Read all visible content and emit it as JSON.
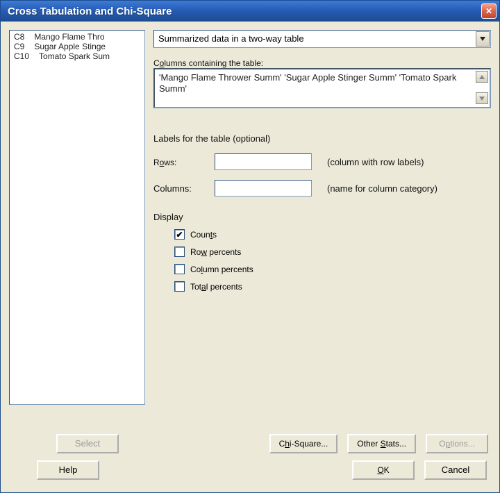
{
  "title": "Cross Tabulation and Chi-Square",
  "listbox": {
    "rows": [
      {
        "col": "C8",
        "name": "Mango Flame Thro"
      },
      {
        "col": "C9",
        "name": "Sugar Apple Stinge"
      },
      {
        "col": "C10",
        "name": "Tomato Spark Sum"
      }
    ]
  },
  "combo": {
    "selected": "Summarized data in a two-way table"
  },
  "columns_label": "Columns containing the table:",
  "columns_value": "'Mango Flame Thrower Summ' 'Sugar Apple Stinger Summ' 'Tomato Spark Summ'",
  "labels_header": "Labels for the table (optional)",
  "rows_label": "Rows:",
  "rows_label_pre": "R",
  "rows_label_u": "o",
  "rows_label_post": "ws:",
  "rows_hint": "(column with row labels)",
  "cols_label": "Columns:",
  "cols_hint": "(name for column category)",
  "display_label": "Display",
  "display": {
    "counts": {
      "label_pre": "Coun",
      "label_u": "t",
      "label_post": "s",
      "checked": true
    },
    "rowpct": {
      "label_pre": "Ro",
      "label_u": "w",
      "label_post": " percents",
      "checked": false
    },
    "colpct": {
      "label_pre": "Co",
      "label_u": "l",
      "label_post": "umn percents",
      "checked": false
    },
    "totpct": {
      "label_pre": "Tot",
      "label_u": "a",
      "label_post": "l percents",
      "checked": false
    }
  },
  "buttons": {
    "select": "Select",
    "chisq_pre": "C",
    "chisq_u": "h",
    "chisq_post": "i-Square...",
    "other_pre": "Other ",
    "other_u": "S",
    "other_post": "tats...",
    "options_pre": "O",
    "options_u": "p",
    "options_post": "tions...",
    "help": "Help",
    "ok_pre": "",
    "ok_u": "O",
    "ok_post": "K",
    "cancel": "Cancel"
  }
}
